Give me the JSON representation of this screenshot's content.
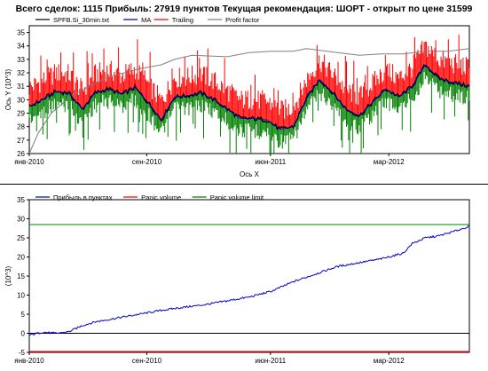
{
  "title": "Всего сделок:  1115 Прибыль: 27919 пунктов   Текущая рекомендация: ШОРТ - открыт по цене 31599",
  "colors": {
    "price": "#000000",
    "ma": "#0000cc",
    "trailing": "#ff0000",
    "profit_factor": "#808080",
    "profit": "#0000cc",
    "panic": "#ff0000",
    "panic_limit": "#008000",
    "buy_bars": "#008000"
  },
  "chart_data": [
    {
      "type": "line",
      "ylabel": "Ось Y (10^3)",
      "xlabel": "Ось X",
      "ylim": [
        26,
        35.5
      ],
      "yticks": [
        26,
        27,
        28,
        29,
        30,
        31,
        32,
        33,
        34,
        35
      ],
      "xticks": [
        "янв-2010",
        "сен-2010",
        "июн-2011",
        "мар-2012"
      ],
      "legend": {
        "placement": "top-left",
        "entries": [
          "SPFB.Si_30min.txt",
          "MA",
          "Trailing",
          "Profit factor"
        ]
      },
      "grid": false,
      "x_range": [
        0,
        1
      ],
      "xtick_positions": [
        0,
        0.267,
        0.548,
        0.817
      ],
      "series": [
        {
          "name": "SPFB.Si_30min.txt",
          "x": [
            0,
            0.03,
            0.06,
            0.09,
            0.12,
            0.15,
            0.18,
            0.21,
            0.24,
            0.27,
            0.3,
            0.33,
            0.36,
            0.39,
            0.42,
            0.45,
            0.48,
            0.51,
            0.54,
            0.57,
            0.6,
            0.63,
            0.66,
            0.69,
            0.72,
            0.75,
            0.78,
            0.81,
            0.84,
            0.87,
            0.9,
            0.93,
            0.96,
            1.0
          ],
          "values": [
            29.5,
            30.0,
            30.6,
            30.5,
            29.3,
            30.5,
            30.8,
            30.4,
            30.9,
            29.8,
            28.5,
            30.2,
            30.3,
            30.5,
            30.0,
            29.3,
            28.6,
            28.6,
            28.5,
            27.8,
            28.0,
            30.1,
            31.5,
            30.5,
            29.3,
            28.8,
            29.8,
            30.8,
            30.2,
            31.0,
            32.6,
            31.6,
            31.3,
            31.0
          ]
        },
        {
          "name": "Profit factor",
          "x": [
            0,
            0.02,
            0.05,
            0.1,
            0.18,
            0.25,
            0.3,
            0.33,
            0.37,
            0.45,
            0.5,
            0.55,
            0.6,
            0.63,
            0.7,
            0.75,
            0.8,
            0.85,
            0.9,
            0.95,
            1.0
          ],
          "values": [
            25.5,
            27.5,
            29.0,
            30.4,
            31.7,
            32.3,
            32.6,
            33.0,
            33.3,
            33.2,
            33.5,
            33.6,
            33.6,
            33.8,
            33.5,
            33.3,
            33.4,
            33.4,
            33.6,
            33.6,
            33.8
          ]
        }
      ]
    },
    {
      "type": "line",
      "ylabel": "(10^3)",
      "ylim": [
        -5,
        35
      ],
      "yticks": [
        -5,
        0,
        5,
        10,
        15,
        20,
        25,
        30,
        35
      ],
      "xticks": [
        "янв-2010",
        "сен-2010",
        "июн-2011",
        "мар-2012"
      ],
      "legend": {
        "placement": "top-left",
        "entries": [
          "Прибыль в пунктах",
          "Panic volume",
          "Panic volume limit"
        ]
      },
      "grid": false,
      "x_range": [
        0,
        1
      ],
      "xtick_positions": [
        0,
        0.267,
        0.548,
        0.817
      ],
      "series": [
        {
          "name": "Прибыль в пунктах",
          "x": [
            0,
            0.03,
            0.06,
            0.09,
            0.12,
            0.15,
            0.2,
            0.25,
            0.3,
            0.35,
            0.4,
            0.45,
            0.5,
            0.55,
            0.6,
            0.65,
            0.7,
            0.75,
            0.8,
            0.85,
            0.87,
            0.9,
            0.93,
            0.96,
            1.0
          ],
          "values": [
            -0.5,
            0.3,
            0.0,
            0.4,
            2.0,
            3.0,
            4.0,
            5.0,
            6.0,
            6.8,
            7.5,
            8.5,
            9.5,
            11.0,
            13.5,
            15.5,
            17.5,
            18.5,
            19.5,
            21.0,
            23.5,
            25.0,
            25.5,
            26.5,
            28.0
          ]
        },
        {
          "name": "Panic volume",
          "x": [
            0,
            1
          ],
          "values": [
            -4.8,
            -4.8
          ]
        },
        {
          "name": "Panic volume limit",
          "x": [
            0,
            1
          ],
          "values": [
            28.5,
            28.5
          ]
        }
      ]
    }
  ]
}
